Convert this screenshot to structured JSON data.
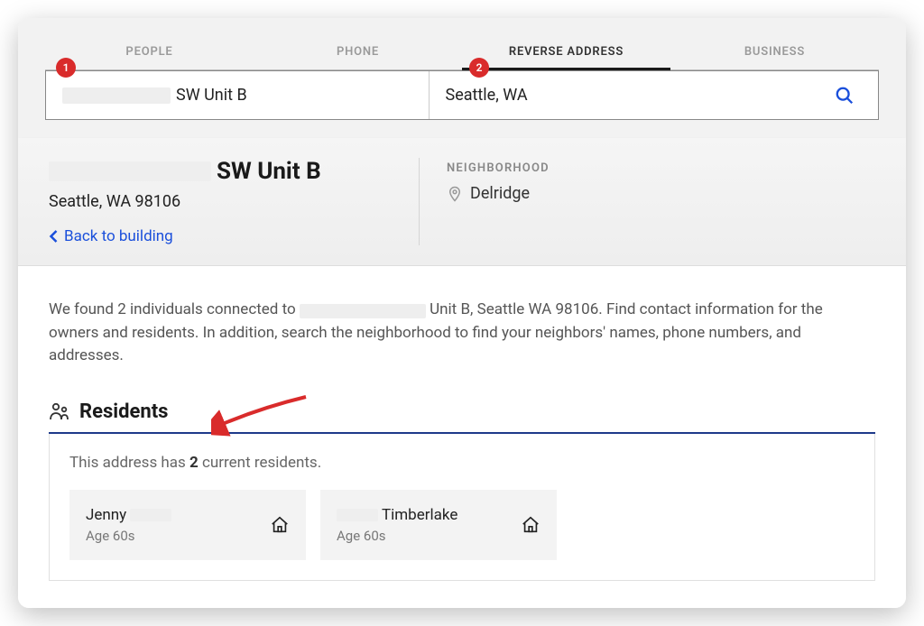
{
  "tabs": {
    "people": "PEOPLE",
    "phone": "PHONE",
    "reverse_address": "REVERSE ADDRESS",
    "business": "BUSINESS"
  },
  "search": {
    "address_suffix": "SW Unit B",
    "city": "Seattle, WA"
  },
  "header": {
    "title_suffix": "SW Unit B",
    "subtitle": "Seattle, WA 98106",
    "back_label": "Back to building",
    "neighborhood_label": "NEIGHBORHOOD",
    "neighborhood": "Delridge"
  },
  "description": {
    "prefix": "We found 2 individuals connected to ",
    "suffix": " Unit B, Seattle WA 98106. Find contact information for the owners and residents. In addition, search the neighborhood to find your neighbors' names, phone numbers, and addresses."
  },
  "residents": {
    "heading": "Residents",
    "summary_prefix": "This address has ",
    "summary_count": "2",
    "summary_suffix": " current residents.",
    "items": [
      {
        "name_prefix": "Jenny",
        "age": "Age 60s"
      },
      {
        "name_suffix": "Timberlake",
        "age": "Age 60s"
      }
    ]
  },
  "badges": {
    "one": "1",
    "two": "2"
  }
}
